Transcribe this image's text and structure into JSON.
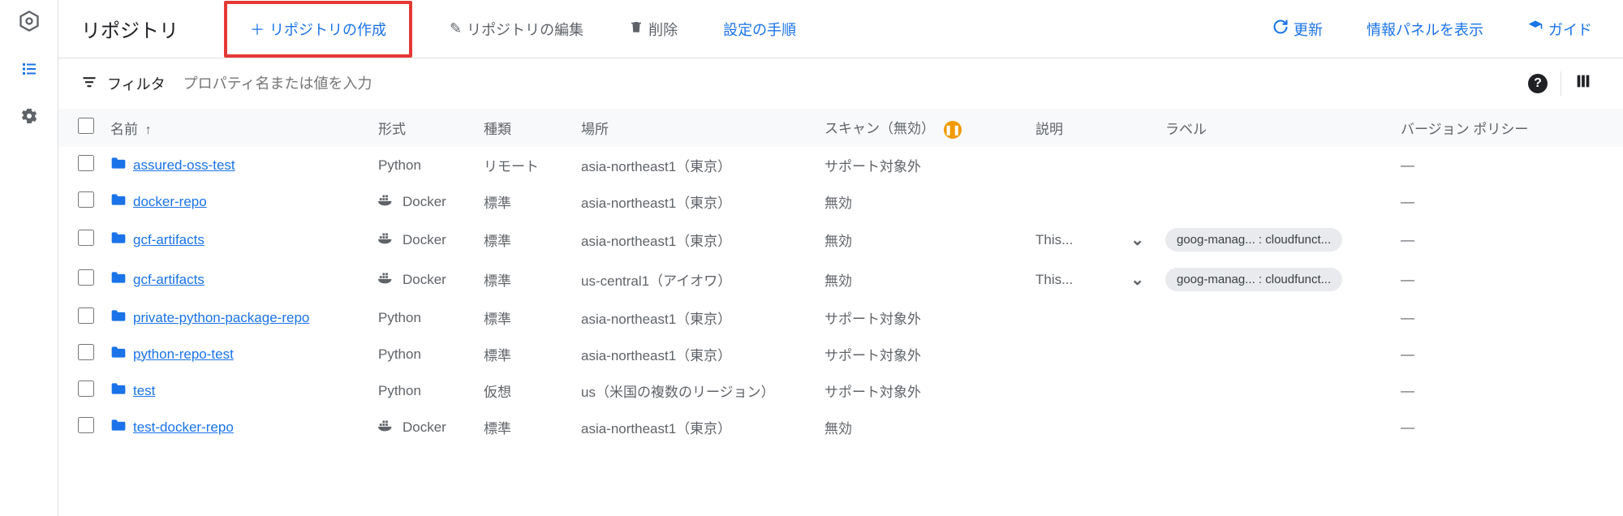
{
  "rail": {
    "logo_name": "artifact-registry-logo",
    "list_name": "list-icon",
    "settings_name": "gear-icon"
  },
  "toolbar": {
    "title": "リポジトリ",
    "create": "リポジトリの作成",
    "edit": "リポジトリの編集",
    "delete": "削除",
    "setup": "設定の手順",
    "refresh": "更新",
    "show_panel": "情報パネルを表示",
    "guide": "ガイド"
  },
  "filter": {
    "label": "フィルタ",
    "placeholder": "プロパティ名または値を入力"
  },
  "columns": {
    "name": "名前",
    "format": "形式",
    "kind": "種類",
    "location": "場所",
    "scan": "スキャン（無効）",
    "description": "説明",
    "labels": "ラベル",
    "version": "バージョン ポリシー"
  },
  "rows": [
    {
      "name": "assured-oss-test",
      "format": "Python",
      "docker": false,
      "kind": "リモート",
      "location": "asia-northeast1（東京）",
      "scan": "サポート対象外",
      "desc": "",
      "chevron": false,
      "label": "",
      "version": "—"
    },
    {
      "name": "docker-repo",
      "format": "Docker",
      "docker": true,
      "kind": "標準",
      "location": "asia-northeast1（東京）",
      "scan": "無効",
      "desc": "",
      "chevron": false,
      "label": "",
      "version": "—"
    },
    {
      "name": "gcf-artifacts",
      "format": "Docker",
      "docker": true,
      "kind": "標準",
      "location": "asia-northeast1（東京）",
      "scan": "無効",
      "desc": "This...",
      "chevron": true,
      "label": "goog-manag... : cloudfunct...",
      "version": "—"
    },
    {
      "name": "gcf-artifacts",
      "format": "Docker",
      "docker": true,
      "kind": "標準",
      "location": "us-central1（アイオワ）",
      "scan": "無効",
      "desc": "This...",
      "chevron": true,
      "label": "goog-manag... : cloudfunct...",
      "version": "—"
    },
    {
      "name": "private-python-package-repo",
      "format": "Python",
      "docker": false,
      "kind": "標準",
      "location": "asia-northeast1（東京）",
      "scan": "サポート対象外",
      "desc": "",
      "chevron": false,
      "label": "",
      "version": "—"
    },
    {
      "name": "python-repo-test",
      "format": "Python",
      "docker": false,
      "kind": "標準",
      "location": "asia-northeast1（東京）",
      "scan": "サポート対象外",
      "desc": "",
      "chevron": false,
      "label": "",
      "version": "—"
    },
    {
      "name": "test",
      "format": "Python",
      "docker": false,
      "kind": "仮想",
      "location": "us（米国の複数のリージョン）",
      "scan": "サポート対象外",
      "desc": "",
      "chevron": false,
      "label": "",
      "version": "—"
    },
    {
      "name": "test-docker-repo",
      "format": "Docker",
      "docker": true,
      "kind": "標準",
      "location": "asia-northeast1（東京）",
      "scan": "無効",
      "desc": "",
      "chevron": false,
      "label": "",
      "version": "—"
    }
  ]
}
